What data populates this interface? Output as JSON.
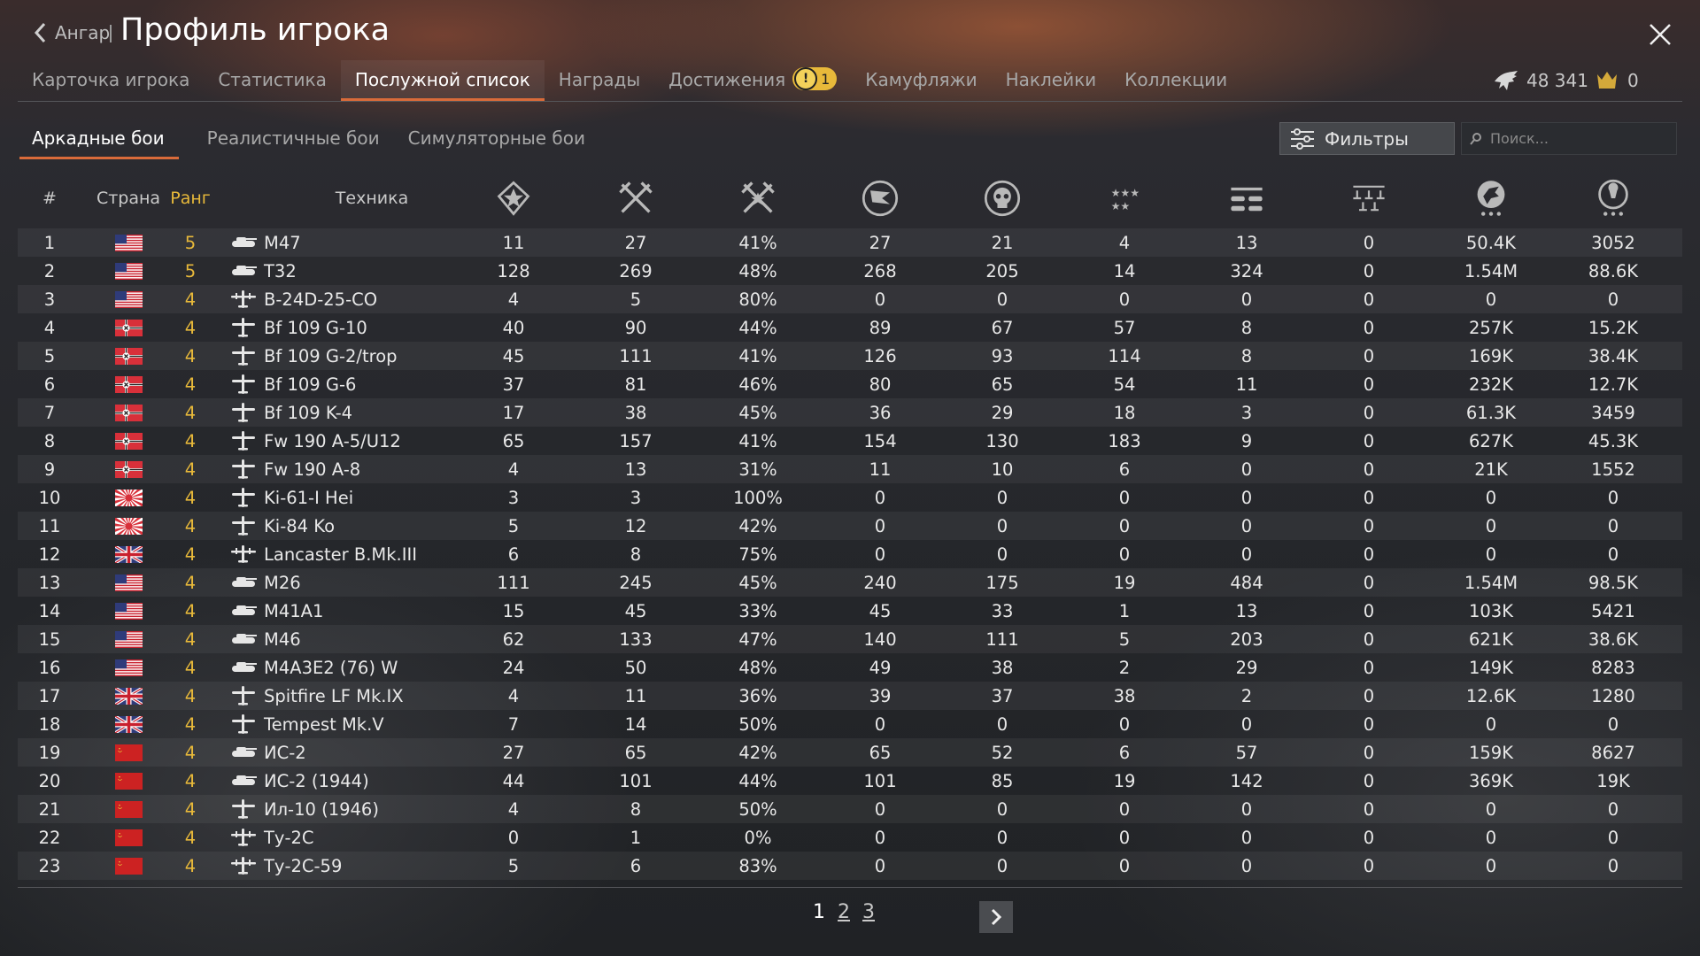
{
  "header": {
    "back_label": "Ангар",
    "title": "Профиль игрока",
    "tabs": [
      {
        "label": "Карточка игрока"
      },
      {
        "label": "Статистика"
      },
      {
        "label": "Послужной список"
      },
      {
        "label": "Награды"
      },
      {
        "label": "Достижения",
        "badge": "1"
      },
      {
        "label": "Камуфляжи"
      },
      {
        "label": "Наклейки"
      },
      {
        "label": "Коллекции"
      }
    ],
    "currency_eagles": "48 341",
    "currency_warbonds": "0"
  },
  "subtabs": [
    {
      "label": "Аркадные бои"
    },
    {
      "label": "Реалистичные бои"
    },
    {
      "label": "Симуляторные бои"
    }
  ],
  "filters_label": "Фильтры",
  "search_placeholder": "Поиск...",
  "columns": {
    "num": "#",
    "country": "Страна",
    "rank": "Ранг",
    "vehicle": "Техника",
    "icons": [
      "battles-star-icon",
      "crossed-swords-icon",
      "victories-swords-icon",
      "respawns-flag-icon",
      "deaths-skull-icon",
      "air-kills-stars-icon",
      "ground-kills-tanks-icon",
      "naval-kills-ships-icon",
      "research-points-eagle-icon",
      "silver-lions-bulb-icon"
    ]
  },
  "rows": [
    {
      "n": "1",
      "flag": "usa",
      "rank": "5",
      "type": "tank",
      "name": "M47",
      "v": [
        "11",
        "27",
        "41%",
        "27",
        "21",
        "4",
        "13",
        "0",
        "50.4K",
        "3052"
      ]
    },
    {
      "n": "2",
      "flag": "usa",
      "rank": "5",
      "type": "tank",
      "name": "T32",
      "v": [
        "128",
        "269",
        "48%",
        "268",
        "205",
        "14",
        "324",
        "0",
        "1.54M",
        "88.6K"
      ]
    },
    {
      "n": "3",
      "flag": "usa",
      "rank": "4",
      "type": "bomber",
      "name": "B-24D-25-CO",
      "v": [
        "4",
        "5",
        "80%",
        "0",
        "0",
        "0",
        "0",
        "0",
        "0",
        "0"
      ]
    },
    {
      "n": "4",
      "flag": "germany",
      "rank": "4",
      "type": "fighter",
      "name": "Bf 109 G-10",
      "v": [
        "40",
        "90",
        "44%",
        "89",
        "67",
        "57",
        "8",
        "0",
        "257K",
        "15.2K"
      ]
    },
    {
      "n": "5",
      "flag": "germany",
      "rank": "4",
      "type": "fighter",
      "name": "Bf 109 G-2/trop",
      "v": [
        "45",
        "111",
        "41%",
        "126",
        "93",
        "114",
        "8",
        "0",
        "169K",
        "38.4K"
      ]
    },
    {
      "n": "6",
      "flag": "germany",
      "rank": "4",
      "type": "fighter",
      "name": "Bf 109 G-6",
      "v": [
        "37",
        "81",
        "46%",
        "80",
        "65",
        "54",
        "11",
        "0",
        "232K",
        "12.7K"
      ]
    },
    {
      "n": "7",
      "flag": "germany",
      "rank": "4",
      "type": "fighter",
      "name": "Bf 109 K-4",
      "v": [
        "17",
        "38",
        "45%",
        "36",
        "29",
        "18",
        "3",
        "0",
        "61.3K",
        "3459"
      ]
    },
    {
      "n": "8",
      "flag": "germany",
      "rank": "4",
      "type": "fighter",
      "name": "Fw 190 A-5/U12",
      "v": [
        "65",
        "157",
        "41%",
        "154",
        "130",
        "183",
        "9",
        "0",
        "627K",
        "45.3K"
      ]
    },
    {
      "n": "9",
      "flag": "germany",
      "rank": "4",
      "type": "fighter",
      "name": "Fw 190 A-8",
      "v": [
        "4",
        "13",
        "31%",
        "11",
        "10",
        "6",
        "0",
        "0",
        "21K",
        "1552"
      ]
    },
    {
      "n": "10",
      "flag": "japan",
      "rank": "4",
      "type": "fighter",
      "name": "Ki-61-I Hei",
      "v": [
        "3",
        "3",
        "100%",
        "0",
        "0",
        "0",
        "0",
        "0",
        "0",
        "0"
      ]
    },
    {
      "n": "11",
      "flag": "japan",
      "rank": "4",
      "type": "fighter",
      "name": "Ki-84 Ko",
      "v": [
        "5",
        "12",
        "42%",
        "0",
        "0",
        "0",
        "0",
        "0",
        "0",
        "0"
      ]
    },
    {
      "n": "12",
      "flag": "uk",
      "rank": "4",
      "type": "bomber",
      "name": "Lancaster B.Mk.III",
      "v": [
        "6",
        "8",
        "75%",
        "0",
        "0",
        "0",
        "0",
        "0",
        "0",
        "0"
      ]
    },
    {
      "n": "13",
      "flag": "usa",
      "rank": "4",
      "type": "tank",
      "name": "M26",
      "v": [
        "111",
        "245",
        "45%",
        "240",
        "175",
        "19",
        "484",
        "0",
        "1.54M",
        "98.5K"
      ]
    },
    {
      "n": "14",
      "flag": "usa",
      "rank": "4",
      "type": "tank",
      "name": "M41A1",
      "v": [
        "15",
        "45",
        "33%",
        "45",
        "33",
        "1",
        "13",
        "0",
        "103K",
        "5421"
      ]
    },
    {
      "n": "15",
      "flag": "usa",
      "rank": "4",
      "type": "tank",
      "name": "M46",
      "v": [
        "62",
        "133",
        "47%",
        "140",
        "111",
        "5",
        "203",
        "0",
        "621K",
        "38.6K"
      ]
    },
    {
      "n": "16",
      "flag": "usa",
      "rank": "4",
      "type": "tank",
      "name": "M4A3E2 (76) W",
      "v": [
        "24",
        "50",
        "48%",
        "49",
        "38",
        "2",
        "29",
        "0",
        "149K",
        "8283"
      ]
    },
    {
      "n": "17",
      "flag": "uk",
      "rank": "4",
      "type": "fighter",
      "name": "Spitfire LF Mk.IX",
      "v": [
        "4",
        "11",
        "36%",
        "39",
        "37",
        "38",
        "2",
        "0",
        "12.6K",
        "1280"
      ]
    },
    {
      "n": "18",
      "flag": "uk",
      "rank": "4",
      "type": "fighter",
      "name": "Tempest Mk.V",
      "v": [
        "7",
        "14",
        "50%",
        "0",
        "0",
        "0",
        "0",
        "0",
        "0",
        "0"
      ]
    },
    {
      "n": "19",
      "flag": "ussr",
      "rank": "4",
      "type": "tank",
      "name": "ИС-2",
      "v": [
        "27",
        "65",
        "42%",
        "65",
        "52",
        "6",
        "57",
        "0",
        "159K",
        "8627"
      ]
    },
    {
      "n": "20",
      "flag": "ussr",
      "rank": "4",
      "type": "tank",
      "name": "ИС-2 (1944)",
      "v": [
        "44",
        "101",
        "44%",
        "101",
        "85",
        "19",
        "142",
        "0",
        "369K",
        "19K"
      ]
    },
    {
      "n": "21",
      "flag": "ussr",
      "rank": "4",
      "type": "fighter",
      "name": "Ил-10 (1946)",
      "v": [
        "4",
        "8",
        "50%",
        "0",
        "0",
        "0",
        "0",
        "0",
        "0",
        "0"
      ]
    },
    {
      "n": "22",
      "flag": "ussr",
      "rank": "4",
      "type": "bomber",
      "name": "Ту-2С",
      "v": [
        "0",
        "1",
        "0%",
        "0",
        "0",
        "0",
        "0",
        "0",
        "0",
        "0"
      ]
    },
    {
      "n": "23",
      "flag": "ussr",
      "rank": "4",
      "type": "bomber",
      "name": "Ту-2С-59",
      "v": [
        "5",
        "6",
        "83%",
        "0",
        "0",
        "0",
        "0",
        "0",
        "0",
        "0"
      ]
    }
  ],
  "pagination": {
    "pages": [
      "1",
      "2",
      "3"
    ],
    "current": "1"
  },
  "colors": {
    "accent": "#d96b3a",
    "rank": "#e8b93a"
  }
}
